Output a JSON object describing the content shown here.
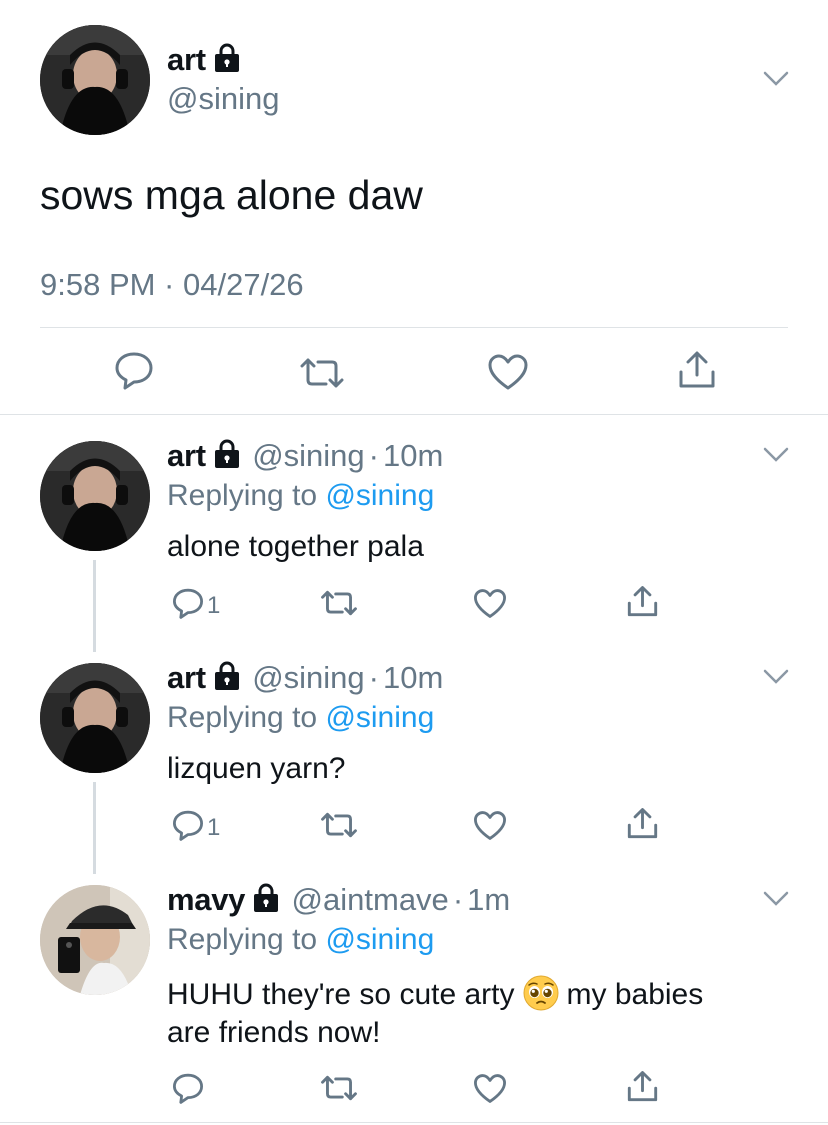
{
  "main_tweet": {
    "display_name": "art",
    "handle": "@sining",
    "text": "sows mga alone daw",
    "timestamp": "9:58 PM · 04/27/26"
  },
  "replies": [
    {
      "display_name": "art",
      "handle": "@sining",
      "time": "10m",
      "replying_prefix": "Replying to ",
      "replying_to": "@sining",
      "text": "alone together pala",
      "reply_count": "1"
    },
    {
      "display_name": "art",
      "handle": "@sining",
      "time": "10m",
      "replying_prefix": "Replying to ",
      "replying_to": "@sining",
      "text": "lizquen yarn?",
      "reply_count": "1"
    },
    {
      "display_name": "mavy",
      "handle": "@aintmave",
      "time": "1m",
      "replying_prefix": "Replying to ",
      "replying_to": "@sining",
      "text_part1": "HUHU they're so cute arty",
      "text_part2": "my babies",
      "text_line2": "are friends now!",
      "emoji": "pleading-face-emoji"
    }
  ],
  "separator": "·",
  "colors": {
    "accent": "#1d9bf0",
    "secondary": "#657786",
    "divider": "#dfe3e6"
  },
  "icons": [
    "lock-icon",
    "chevron-down-icon",
    "reply-icon",
    "retweet-icon",
    "like-icon",
    "share-icon"
  ]
}
